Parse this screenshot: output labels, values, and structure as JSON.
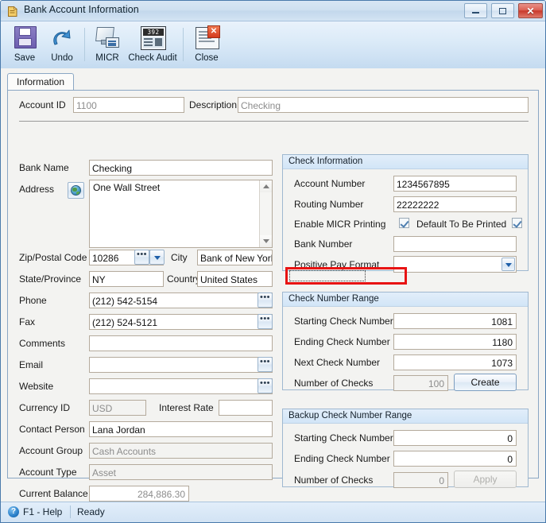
{
  "window": {
    "title": "Bank Account Information",
    "icon": "bank-document-icon",
    "controls": {
      "minimize": "minimize-icon",
      "maximize": "maximize-icon",
      "close": "✕"
    }
  },
  "toolbar": {
    "items": [
      {
        "label": "Save",
        "icon": "floppy-disk-icon"
      },
      {
        "label": "Undo",
        "icon": "undo-arrow-icon"
      },
      {
        "label": "MICR",
        "icon": "micr-device-icon"
      },
      {
        "label": "Check Audit",
        "icon": "check-audit-icon",
        "display": "392"
      },
      {
        "label": "Close",
        "icon": "close-window-icon"
      }
    ]
  },
  "tabs": [
    {
      "label": "Information",
      "selected": true
    }
  ],
  "header_fields": {
    "account_id_label": "Account ID",
    "account_id_value": "1100",
    "description_label": "Description",
    "description_value": "Checking"
  },
  "left_form": {
    "bank_name_label": "Bank Name",
    "bank_name_value": "Checking",
    "address_label": "Address",
    "address_value": "One Wall Street",
    "zip_label": "Zip/Postal Code",
    "zip_value": "10286",
    "city_label": "City",
    "city_value": "Bank of New York",
    "state_label": "State/Province",
    "state_value": "NY",
    "country_label": "Country",
    "country_value": "United States",
    "phone_label": "Phone",
    "phone_value": "(212) 542-5154",
    "fax_label": "Fax",
    "fax_value": "(212) 524-5121",
    "comments_label": "Comments",
    "comments_value": "",
    "email_label": "Email",
    "email_value": "",
    "website_label": "Website",
    "website_value": "",
    "currency_label": "Currency ID",
    "currency_value": "USD",
    "interest_label": "Interest Rate",
    "interest_value": "",
    "contact_label": "Contact Person",
    "contact_value": "Lana Jordan",
    "group_label": "Account Group",
    "group_value": "Cash Accounts",
    "type_label": "Account Type",
    "type_value": "Asset",
    "balance_label": "Current Balance",
    "balance_value": "284,886.30",
    "ellipsis_glyph": "•••"
  },
  "check_information": {
    "title": "Check Information",
    "account_number_label": "Account Number",
    "account_number_value": "1234567895",
    "routing_number_label": "Routing Number",
    "routing_number_value": "22222222",
    "enable_micr_label": "Enable MICR Printing",
    "enable_micr_checked": true,
    "default_printed_label": "Default To Be Printed",
    "default_printed_checked": true,
    "bank_number_label": "Bank Number",
    "bank_number_value": "",
    "positive_pay_label": "Positive Pay Format",
    "positive_pay_value": ""
  },
  "check_number_range": {
    "title": "Check Number Range",
    "starting_label": "Starting Check Number",
    "starting_value": "1081",
    "ending_label": "Ending Check Number",
    "ending_value": "1180",
    "next_label": "Next Check Number",
    "next_value": "1073",
    "count_label": "Number of Checks",
    "count_value": "100",
    "create_button": "Create"
  },
  "backup_check_number_range": {
    "title": "Backup Check Number Range",
    "starting_label": "Starting Check Number",
    "starting_value": "0",
    "ending_label": "Ending Check Number",
    "ending_value": "0",
    "count_label": "Number of Checks",
    "count_value": "0",
    "apply_button": "Apply"
  },
  "statusbar": {
    "help_icon": "?",
    "help_label": "F1 - Help",
    "status": "Ready"
  },
  "colors": {
    "highlight_red": "#e81313",
    "titlebar_blue": "#cfe0f0",
    "group_header": "#d9e9f8",
    "close_red": "#c8392c"
  }
}
